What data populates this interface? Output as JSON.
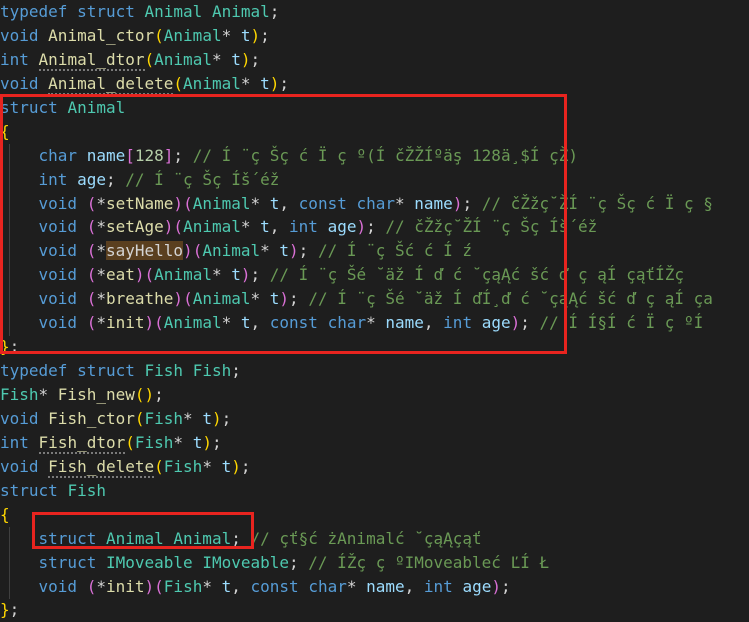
{
  "lines": [
    [
      [
        "k",
        "typedef"
      ],
      [
        "p",
        " "
      ],
      [
        "k",
        "struct"
      ],
      [
        "p",
        " "
      ],
      [
        "t",
        "Animal"
      ],
      [
        "p",
        " "
      ],
      [
        "t",
        "Animal"
      ],
      [
        "p",
        ";"
      ]
    ],
    [
      [
        "k",
        "void"
      ],
      [
        "p",
        " "
      ],
      [
        "f",
        "Animal_ctor"
      ],
      [
        "b1",
        "("
      ],
      [
        "t",
        "Animal"
      ],
      [
        "p",
        "* "
      ],
      [
        "v",
        "t"
      ],
      [
        "b1",
        ")"
      ],
      [
        "p",
        ";"
      ]
    ],
    [
      [
        "k",
        "int"
      ],
      [
        "p",
        " "
      ],
      [
        "f",
        "Animal_dtor"
      ],
      [
        "b1",
        "("
      ],
      [
        "t",
        "Animal"
      ],
      [
        "p",
        "* "
      ],
      [
        "v",
        "t"
      ],
      [
        "b1",
        ")"
      ],
      [
        "p",
        ";"
      ]
    ],
    [
      [
        "k",
        "void"
      ],
      [
        "p",
        " "
      ],
      [
        "f",
        "Animal_delete"
      ],
      [
        "b1",
        "("
      ],
      [
        "t",
        "Animal"
      ],
      [
        "p",
        "* "
      ],
      [
        "v",
        "t"
      ],
      [
        "b1",
        ")"
      ],
      [
        "p",
        ";"
      ]
    ],
    [
      [
        "k",
        "struct"
      ],
      [
        "p",
        " "
      ],
      [
        "t",
        "Animal"
      ]
    ],
    [
      [
        "b1",
        "{"
      ]
    ],
    [
      [
        "p",
        "    "
      ],
      [
        "k",
        "char"
      ],
      [
        "p",
        " "
      ],
      [
        "v",
        "name"
      ],
      [
        "b2",
        "["
      ],
      [
        "n",
        "128"
      ],
      [
        "b2",
        "]"
      ],
      [
        "p",
        "; "
      ],
      [
        "c",
        "// Í ¨ç Šç ć Ï ç º(Í čŽŽÍºäş 128ä¸$Í çŽ)"
      ]
    ],
    [
      [
        "p",
        "    "
      ],
      [
        "k",
        "int"
      ],
      [
        "p",
        " "
      ],
      [
        "v",
        "age"
      ],
      [
        "p",
        "; "
      ],
      [
        "c",
        "// Í ¨ç Šç Íš´éž "
      ]
    ],
    [
      [
        "p",
        "    "
      ],
      [
        "k",
        "void"
      ],
      [
        "p",
        " "
      ],
      [
        "b2",
        "("
      ],
      [
        "p",
        "*"
      ],
      [
        "f",
        "setName"
      ],
      [
        "b2",
        ")"
      ],
      [
        "b2",
        "("
      ],
      [
        "t",
        "Animal"
      ],
      [
        "p",
        "* "
      ],
      [
        "v",
        "t"
      ],
      [
        "p",
        ", "
      ],
      [
        "k",
        "const"
      ],
      [
        "p",
        " "
      ],
      [
        "k",
        "char"
      ],
      [
        "p",
        "* "
      ],
      [
        "v",
        "name"
      ],
      [
        "b2",
        ")"
      ],
      [
        "p",
        "; "
      ],
      [
        "c",
        "// čŽžç˘ŽÍ ¨ç Šç ć Ï ç §"
      ]
    ],
    [
      [
        "p",
        "    "
      ],
      [
        "k",
        "void"
      ],
      [
        "p",
        " "
      ],
      [
        "b2",
        "("
      ],
      [
        "p",
        "*"
      ],
      [
        "f",
        "setAge"
      ],
      [
        "b2",
        ")"
      ],
      [
        "b2",
        "("
      ],
      [
        "t",
        "Animal"
      ],
      [
        "p",
        "* "
      ],
      [
        "v",
        "t"
      ],
      [
        "p",
        ", "
      ],
      [
        "k",
        "int"
      ],
      [
        "p",
        " "
      ],
      [
        "v",
        "age"
      ],
      [
        "b2",
        ")"
      ],
      [
        "p",
        "; "
      ],
      [
        "c",
        "// čŽžç˘ŽÍ ¨ç Šç Íš´éž "
      ]
    ],
    [
      [
        "p",
        "    "
      ],
      [
        "k",
        "void"
      ],
      [
        "p",
        " "
      ],
      [
        "b2",
        "("
      ],
      [
        "p",
        "*"
      ],
      [
        "hl",
        "sayHello"
      ],
      [
        "b2",
        ")"
      ],
      [
        "b2",
        "("
      ],
      [
        "t",
        "Animal"
      ],
      [
        "p",
        "* "
      ],
      [
        "v",
        "t"
      ],
      [
        "b2",
        ")"
      ],
      [
        "p",
        "; "
      ],
      [
        "c",
        "// Í ¨ç Šć ć Í ź"
      ]
    ],
    [
      [
        "p",
        "    "
      ],
      [
        "k",
        "void"
      ],
      [
        "p",
        " "
      ],
      [
        "b2",
        "("
      ],
      [
        "p",
        "*"
      ],
      [
        "f",
        "eat"
      ],
      [
        "b2",
        ")"
      ],
      [
        "b2",
        "("
      ],
      [
        "t",
        "Animal"
      ],
      [
        "p",
        "* "
      ],
      [
        "v",
        "t"
      ],
      [
        "b2",
        ")"
      ],
      [
        "p",
        "; "
      ],
      [
        "c",
        "// Í ¨ç Šé ˘äž Í ď ć ˘çąĄć šć ď ç ąÍ çąťÍŽç "
      ]
    ],
    [
      [
        "p",
        "    "
      ],
      [
        "k",
        "void"
      ],
      [
        "p",
        " "
      ],
      [
        "b2",
        "("
      ],
      [
        "p",
        "*"
      ],
      [
        "f",
        "breathe"
      ],
      [
        "b2",
        ")"
      ],
      [
        "b2",
        "("
      ],
      [
        "t",
        "Animal"
      ],
      [
        "p",
        "* "
      ],
      [
        "v",
        "t"
      ],
      [
        "b2",
        ")"
      ],
      [
        "p",
        "; "
      ],
      [
        "c",
        "// Í ¨ç Šé ˘äž Í ďÍ¸ď ć ˘çąĄć šć ď ç ąÍ ça"
      ]
    ],
    [
      [
        "p",
        "    "
      ],
      [
        "k",
        "void"
      ],
      [
        "p",
        " "
      ],
      [
        "b2",
        "("
      ],
      [
        "p",
        "*"
      ],
      [
        "f",
        "init"
      ],
      [
        "b2",
        ")"
      ],
      [
        "b2",
        "("
      ],
      [
        "t",
        "Animal"
      ],
      [
        "p",
        "* "
      ],
      [
        "v",
        "t"
      ],
      [
        "p",
        ", "
      ],
      [
        "k",
        "const"
      ],
      [
        "p",
        " "
      ],
      [
        "k",
        "char"
      ],
      [
        "p",
        "* "
      ],
      [
        "v",
        "name"
      ],
      [
        "p",
        ", "
      ],
      [
        "k",
        "int"
      ],
      [
        "p",
        " "
      ],
      [
        "v",
        "age"
      ],
      [
        "b2",
        ")"
      ],
      [
        "p",
        "; "
      ],
      [
        "c",
        "// Í Í§Í ć Ï ç ºÍ "
      ]
    ],
    [
      [
        "b1",
        "}"
      ],
      [
        "p",
        ";"
      ]
    ],
    [
      [
        "k",
        "typedef"
      ],
      [
        "p",
        " "
      ],
      [
        "k",
        "struct"
      ],
      [
        "p",
        " "
      ],
      [
        "t",
        "Fish"
      ],
      [
        "p",
        " "
      ],
      [
        "t",
        "Fish"
      ],
      [
        "p",
        ";"
      ]
    ],
    [
      [
        "t",
        "Fish"
      ],
      [
        "p",
        "* "
      ],
      [
        "f",
        "Fish_new"
      ],
      [
        "b1",
        "("
      ],
      [
        "b1",
        ")"
      ],
      [
        "p",
        ";"
      ]
    ],
    [
      [
        "k",
        "void"
      ],
      [
        "p",
        " "
      ],
      [
        "f",
        "Fish_ctor"
      ],
      [
        "b1",
        "("
      ],
      [
        "t",
        "Fish"
      ],
      [
        "p",
        "* "
      ],
      [
        "v",
        "t"
      ],
      [
        "b1",
        ")"
      ],
      [
        "p",
        ";"
      ]
    ],
    [
      [
        "k",
        "int"
      ],
      [
        "p",
        " "
      ],
      [
        "f",
        "Fish_dtor"
      ],
      [
        "b1",
        "("
      ],
      [
        "t",
        "Fish"
      ],
      [
        "p",
        "* "
      ],
      [
        "v",
        "t"
      ],
      [
        "b1",
        ")"
      ],
      [
        "p",
        ";"
      ]
    ],
    [
      [
        "k",
        "void"
      ],
      [
        "p",
        " "
      ],
      [
        "f",
        "Fish_delete"
      ],
      [
        "b1",
        "("
      ],
      [
        "t",
        "Fish"
      ],
      [
        "p",
        "* "
      ],
      [
        "v",
        "t"
      ],
      [
        "b1",
        ")"
      ],
      [
        "p",
        ";"
      ]
    ],
    [
      [
        "k",
        "struct"
      ],
      [
        "p",
        " "
      ],
      [
        "t",
        "Fish"
      ]
    ],
    [
      [
        "b1",
        "{"
      ]
    ],
    [
      [
        "p",
        "    "
      ],
      [
        "k",
        "struct"
      ],
      [
        "p",
        " "
      ],
      [
        "t",
        "Animal"
      ],
      [
        "p",
        " "
      ],
      [
        "t",
        "Animal"
      ],
      [
        "p",
        "; "
      ],
      [
        "c",
        "// çť§ć żAnimalć ˘çąĄçąť"
      ]
    ],
    [
      [
        "p",
        "    "
      ],
      [
        "k",
        "struct"
      ],
      [
        "p",
        " "
      ],
      [
        "t",
        "IMoveable"
      ],
      [
        "p",
        " "
      ],
      [
        "t",
        "IMoveable"
      ],
      [
        "p",
        "; "
      ],
      [
        "c",
        "// ÍŽç ç ºIMoveableć ĽÍ Ł"
      ]
    ],
    [
      [
        "p",
        "    "
      ],
      [
        "k",
        "void"
      ],
      [
        "p",
        " "
      ],
      [
        "b2",
        "("
      ],
      [
        "p",
        "*"
      ],
      [
        "f",
        "init"
      ],
      [
        "b2",
        ")"
      ],
      [
        "b2",
        "("
      ],
      [
        "t",
        "Fish"
      ],
      [
        "p",
        "* "
      ],
      [
        "v",
        "t"
      ],
      [
        "p",
        ", "
      ],
      [
        "k",
        "const"
      ],
      [
        "p",
        " "
      ],
      [
        "k",
        "char"
      ],
      [
        "p",
        "* "
      ],
      [
        "v",
        "name"
      ],
      [
        "p",
        ", "
      ],
      [
        "k",
        "int"
      ],
      [
        "p",
        " "
      ],
      [
        "v",
        "age"
      ],
      [
        "b2",
        ")"
      ],
      [
        "p",
        ";"
      ]
    ],
    [
      [
        "b1",
        "}"
      ],
      [
        "p",
        ";"
      ]
    ]
  ],
  "colors": {
    "background": "#1e1e1e",
    "keyword": "#569cd6",
    "type": "#4ec9b0",
    "function": "#dcdcaa",
    "variable": "#9cdcfe",
    "number": "#b5cea8",
    "comment": "#6a9955",
    "highlight_box": "#e8241f"
  }
}
